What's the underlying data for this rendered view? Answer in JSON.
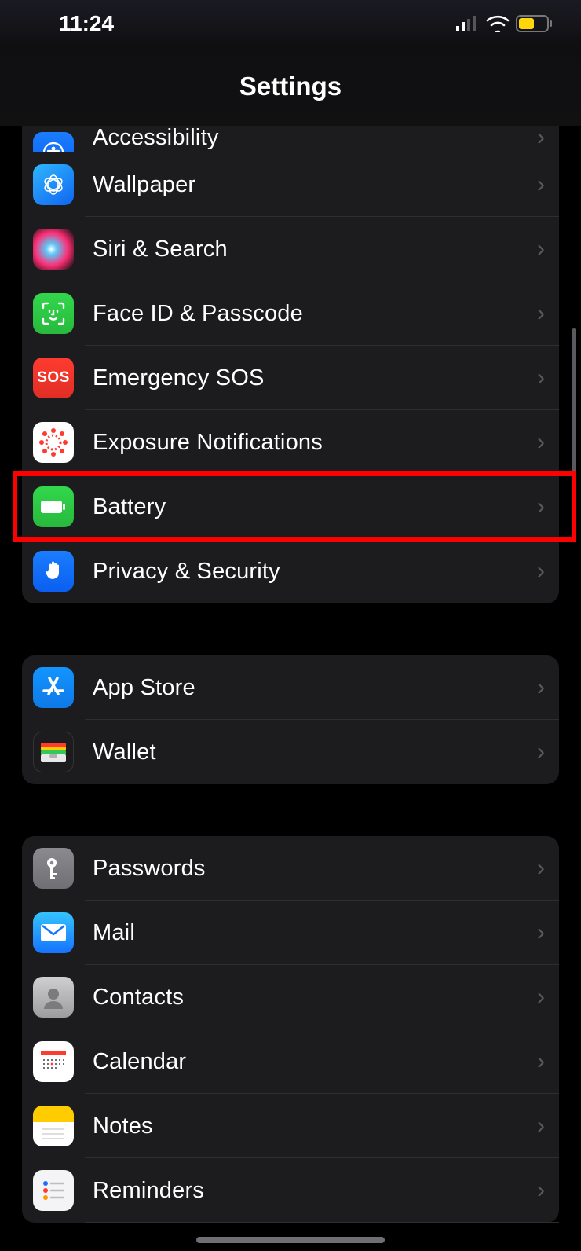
{
  "status": {
    "time": "11:24"
  },
  "header": {
    "title": "Settings"
  },
  "groups": [
    {
      "id": "general",
      "items": [
        {
          "key": "accessibility",
          "label": "Accessibility"
        },
        {
          "key": "wallpaper",
          "label": "Wallpaper"
        },
        {
          "key": "siri",
          "label": "Siri & Search"
        },
        {
          "key": "faceid",
          "label": "Face ID & Passcode"
        },
        {
          "key": "sos",
          "label": "Emergency SOS",
          "iconText": "SOS"
        },
        {
          "key": "exposure",
          "label": "Exposure Notifications"
        },
        {
          "key": "battery",
          "label": "Battery",
          "highlighted": true
        },
        {
          "key": "privacy",
          "label": "Privacy & Security"
        }
      ]
    },
    {
      "id": "store",
      "items": [
        {
          "key": "appstore",
          "label": "App Store"
        },
        {
          "key": "wallet",
          "label": "Wallet"
        }
      ]
    },
    {
      "id": "apps",
      "items": [
        {
          "key": "passwords",
          "label": "Passwords"
        },
        {
          "key": "mail",
          "label": "Mail"
        },
        {
          "key": "contacts",
          "label": "Contacts"
        },
        {
          "key": "calendar",
          "label": "Calendar"
        },
        {
          "key": "notes",
          "label": "Notes"
        },
        {
          "key": "reminders",
          "label": "Reminders"
        }
      ]
    }
  ]
}
